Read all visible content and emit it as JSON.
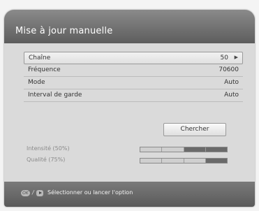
{
  "screen": {
    "title": "Mise à jour manuelle"
  },
  "settings": [
    {
      "label": "Chaîne",
      "value": "50",
      "selected": true
    },
    {
      "label": "Fréquence",
      "value": "70600"
    },
    {
      "label": "Mode",
      "value": "Auto"
    },
    {
      "label": "Interval de garde",
      "value": "Auto"
    }
  ],
  "search_button": {
    "label": "Chercher"
  },
  "signal": {
    "intensity": {
      "label": "Intensité (50%)",
      "level": 0.5
    },
    "quality": {
      "label": "Qualité (75%)",
      "level": 0.75
    }
  },
  "footer": {
    "ok_key": "OK",
    "separator": "/",
    "hint": "Sélectionner ou lancer l'option"
  },
  "colors": {
    "header": "#6e6e6e",
    "content_bg": "#dadada",
    "footer": "#6a6a6a"
  }
}
